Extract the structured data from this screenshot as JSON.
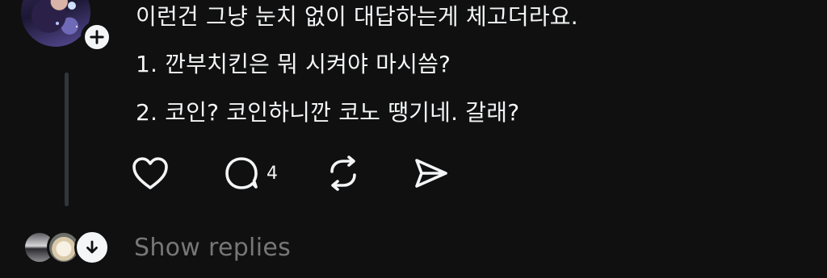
{
  "post": {
    "lines": [
      "이런건 그냥 눈치 없이 대답하는게 체고더라요.",
      "1. 깐부치킨은 뭐 시켜야 마시씀?",
      "2. 코인? 코인하니깐 코노 땡기네. 갈래?"
    ],
    "author_avatar_icon": "avatar-image",
    "follow_icon": "plus-icon"
  },
  "actions": {
    "like_icon": "heart-icon",
    "reply_icon": "comment-bubble-icon",
    "reply_count": "4",
    "repost_icon": "repost-icon",
    "share_icon": "send-icon"
  },
  "replies": {
    "label": "Show replies",
    "expand_icon": "arrow-down-icon"
  },
  "colors": {
    "background": "#101010",
    "text": "#f3f5f7",
    "muted": "#777777",
    "thread_line": "#333638"
  }
}
